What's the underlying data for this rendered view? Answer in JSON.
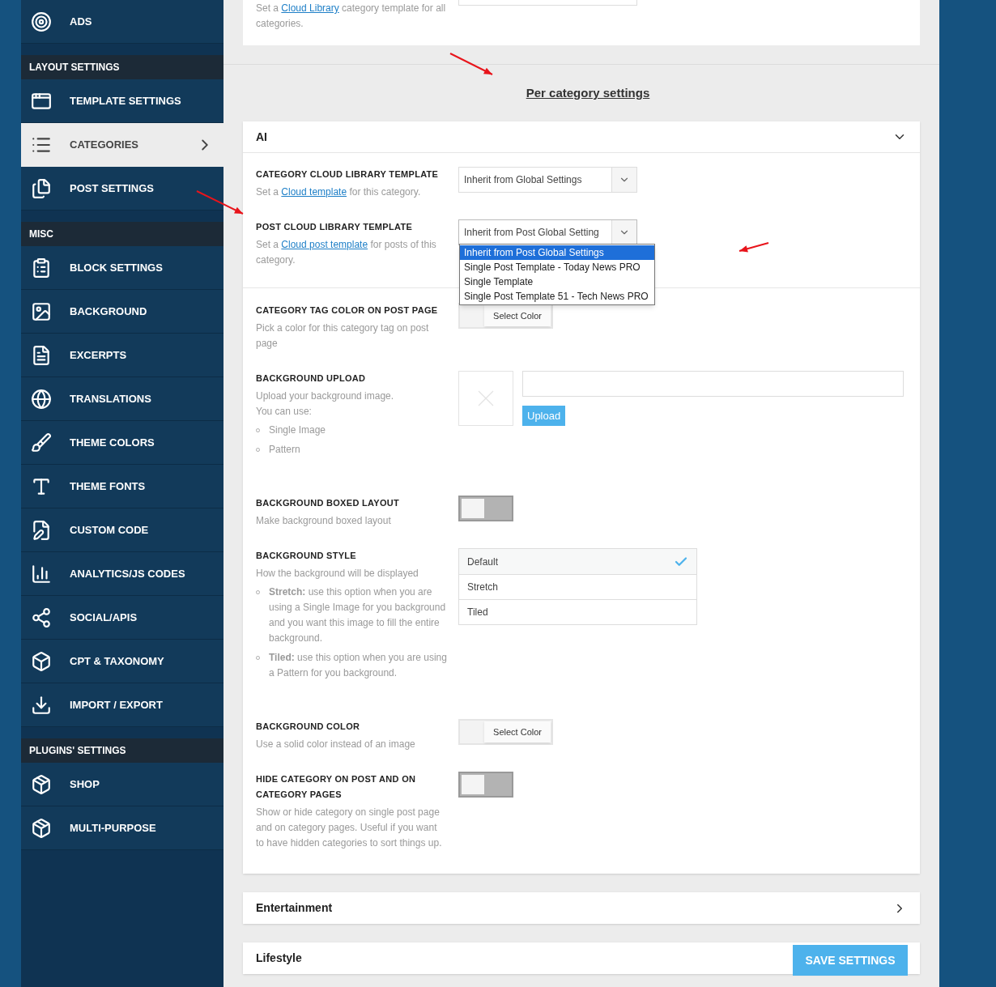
{
  "sidebar": {
    "items": [
      {
        "kind": "item",
        "label": "ADS",
        "selected": false
      },
      {
        "kind": "header",
        "label": "LAYOUT SETTINGS"
      },
      {
        "kind": "item",
        "label": "TEMPLATE SETTINGS",
        "selected": false
      },
      {
        "kind": "item",
        "label": "CATEGORIES",
        "selected": true
      },
      {
        "kind": "item",
        "label": "POST SETTINGS",
        "selected": false
      },
      {
        "kind": "header",
        "label": "MISC"
      },
      {
        "kind": "item",
        "label": "BLOCK SETTINGS",
        "selected": false
      },
      {
        "kind": "item",
        "label": "BACKGROUND",
        "selected": false
      },
      {
        "kind": "item",
        "label": "EXCERPTS",
        "selected": false
      },
      {
        "kind": "item",
        "label": "TRANSLATIONS",
        "selected": false
      },
      {
        "kind": "item",
        "label": "THEME COLORS",
        "selected": false
      },
      {
        "kind": "item",
        "label": "THEME FONTS",
        "selected": false
      },
      {
        "kind": "item",
        "label": "CUSTOM CODE",
        "selected": false
      },
      {
        "kind": "item",
        "label": "ANALYTICS/JS CODES",
        "selected": false
      },
      {
        "kind": "item",
        "label": "SOCIAL/APIS",
        "selected": false
      },
      {
        "kind": "item",
        "label": "CPT & TAXONOMY",
        "selected": false
      },
      {
        "kind": "item",
        "label": "IMPORT / EXPORT",
        "selected": false
      },
      {
        "kind": "header",
        "label": "PLUGINS' SETTINGS"
      },
      {
        "kind": "item",
        "label": "SHOP",
        "selected": false
      },
      {
        "kind": "item",
        "label": "MULTI-PURPOSE",
        "selected": false
      }
    ]
  },
  "top_card": {
    "description": [
      {
        "text": "Set a "
      },
      {
        "link": "Cloud Library"
      },
      {
        "text": " category template for all categories."
      }
    ]
  },
  "section_title": "Per category settings",
  "categories": [
    {
      "name": "AI",
      "expanded": true,
      "fields": [
        {
          "kind": "select",
          "label": "CATEGORY CLOUD LIBRARY TEMPLATE",
          "description": [
            {
              "text": "Set a "
            },
            {
              "link": "Cloud template"
            },
            {
              "text": " for this category."
            }
          ],
          "value": "Inherit from Global Settings",
          "open": false
        },
        {
          "kind": "select",
          "label": "POST CLOUD LIBRARY TEMPLATE",
          "description": [
            {
              "text": "Set a "
            },
            {
              "link": "Cloud post template"
            },
            {
              "text": " for posts of this category."
            }
          ],
          "value": "Inherit from Post Global Setting",
          "open": true,
          "options": [
            {
              "label": "Inherit from Post Global Settings",
              "selected": true
            },
            {
              "label": "Single Post Template - Today News PRO",
              "selected": false
            },
            {
              "label": "Single Template",
              "selected": false
            },
            {
              "label": "Single Post Template 51 - Tech News PRO",
              "selected": false
            }
          ]
        },
        {
          "kind": "divider"
        },
        {
          "kind": "color",
          "label": "CATEGORY TAG COLOR ON POST PAGE",
          "description": [
            {
              "text": "Pick a color for this category tag on post page"
            }
          ],
          "button": "Select Color"
        },
        {
          "kind": "upload",
          "label": "BACKGROUND UPLOAD",
          "description": [
            {
              "text": "Upload your background image."
            }
          ],
          "note": "You can use:",
          "bullets": [
            "Single Image",
            "Pattern"
          ],
          "button": "Upload"
        },
        {
          "kind": "toggle",
          "label": "BACKGROUND BOXED LAYOUT",
          "description": [
            {
              "text": "Make background boxed layout"
            }
          ],
          "on": false
        },
        {
          "kind": "radio_list",
          "label": "BACKGROUND STYLE",
          "description": [
            {
              "text": "How the background will be displayed"
            }
          ],
          "bullets": [
            "**Stretch:** use this option when you are using a Single Image for you background and you want this image to fill the entire background.",
            "**Tiled:** use this option when you are using a Pattern for you background."
          ],
          "options": [
            {
              "label": "Default",
              "selected": true
            },
            {
              "label": "Stretch",
              "selected": false
            },
            {
              "label": "Tiled",
              "selected": false
            }
          ]
        },
        {
          "kind": "color",
          "label": "BACKGROUND COLOR",
          "description": [
            {
              "text": "Use a solid color instead of an image"
            }
          ],
          "button": "Select Color"
        },
        {
          "kind": "toggle",
          "label": "HIDE CATEGORY ON POST AND ON CATEGORY PAGES",
          "description": [
            {
              "text": "Show or hide category on single post page and on category pages. Useful if you want to have hidden categories to sort things up."
            }
          ],
          "on": false
        }
      ]
    },
    {
      "name": "Entertainment",
      "expanded": false
    },
    {
      "name": "Lifestyle",
      "expanded": false
    }
  ],
  "save_button": "SAVE SETTINGS"
}
